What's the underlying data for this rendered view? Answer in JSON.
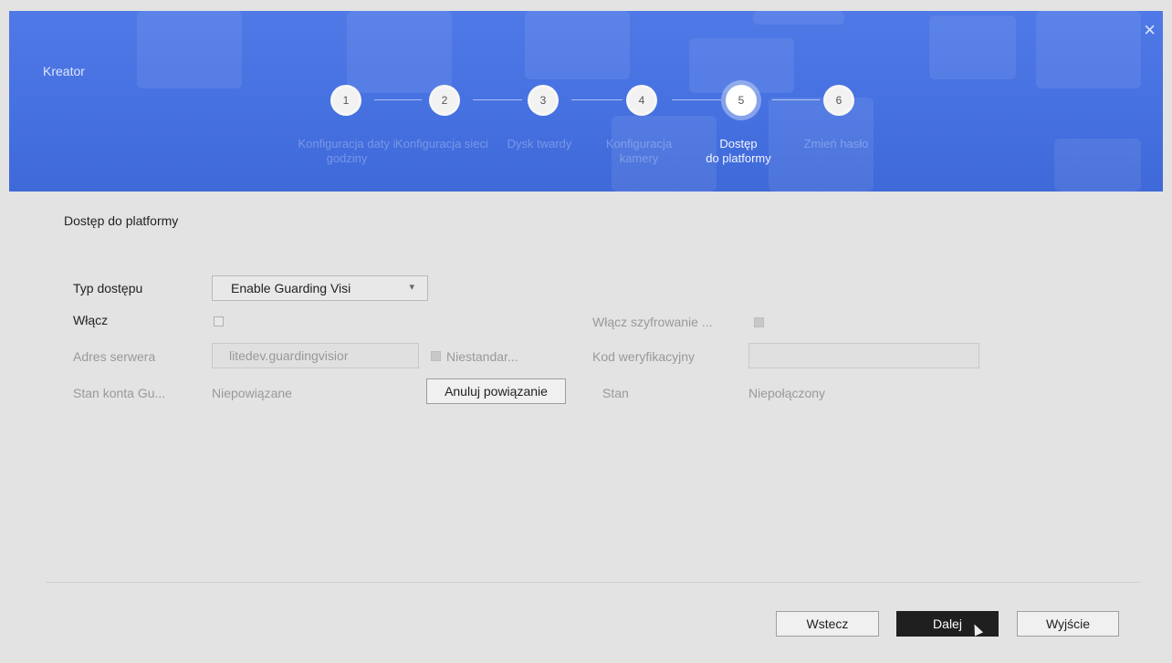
{
  "window": {
    "title": "Kreator",
    "close_glyph": "×"
  },
  "steps": [
    {
      "number": "1",
      "label": "Konfiguracja daty i godziny"
    },
    {
      "number": "2",
      "label": "Konfiguracja sieci"
    },
    {
      "number": "3",
      "label": "Dysk twardy"
    },
    {
      "number": "4",
      "label": "Konfiguracja kamery"
    },
    {
      "number": "5",
      "label_line1": "Dostęp",
      "label_line2": "do platformy"
    },
    {
      "number": "6",
      "label": "Zmień hasło"
    }
  ],
  "active_step": 5,
  "section": {
    "title": "Dostęp do platformy"
  },
  "form": {
    "access_type_label": "Typ dostępu",
    "access_type_value": "Enable Guarding Visi",
    "enable_label": "Włącz",
    "enable_checked": false,
    "encryption_label": "Włącz szyfrowanie ...",
    "encryption_checked": true,
    "server_label": "Adres serwera",
    "server_value": "litedev.guardingvisior",
    "custom_label": "Niestandar...",
    "custom_checked": true,
    "verify_label": "Kod weryfikacyjny",
    "verify_value": "",
    "account_label": "Stan konta Gu...",
    "account_value": "Niepowiązane",
    "unbind_button": "Anuluj powiązanie",
    "status_label": "Stan",
    "status_value": "Niepołączony"
  },
  "footer": {
    "back": "Wstecz",
    "next": "Dalej",
    "exit": "Wyjście"
  },
  "colors": {
    "header": "#4570e0",
    "primary_button": "#1f1f1f",
    "background": "#e3e3e3"
  }
}
